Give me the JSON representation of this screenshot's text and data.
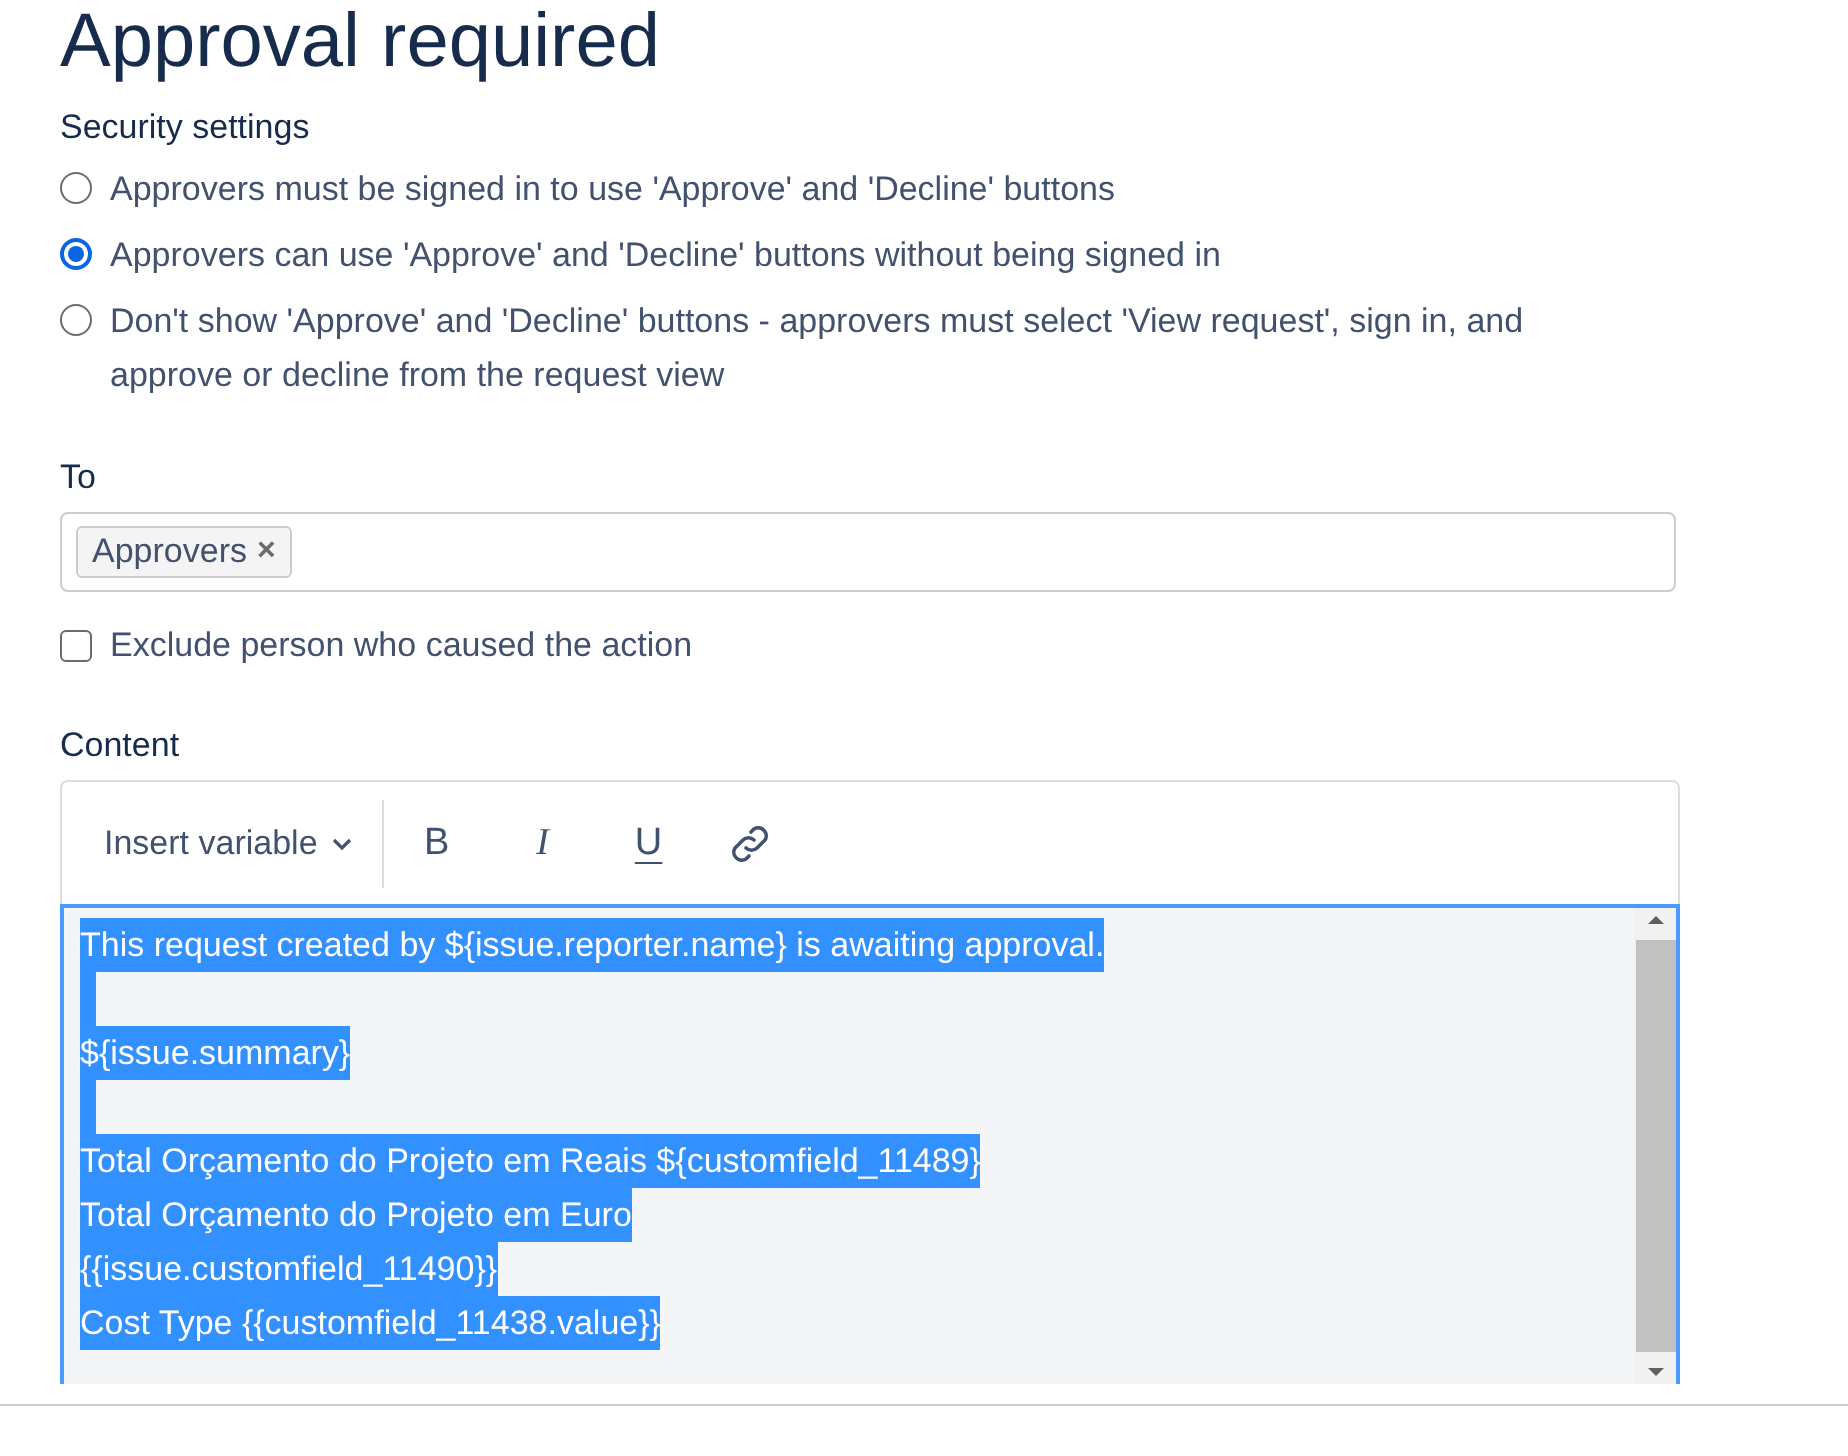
{
  "title": "Approval required",
  "security": {
    "label": "Security settings",
    "options": [
      {
        "label": "Approvers must be signed in to use 'Approve' and 'Decline' buttons",
        "selected": false
      },
      {
        "label": "Approvers can use 'Approve' and 'Decline' buttons without being signed in",
        "selected": true
      },
      {
        "label": "Don't show 'Approve' and 'Decline' buttons - approvers must select 'View request', sign in, and approve or decline from the request view",
        "selected": false
      }
    ]
  },
  "to": {
    "label": "To",
    "tags": [
      {
        "label": "Approvers",
        "remove": "×"
      }
    ]
  },
  "exclude": {
    "label": "Exclude person who caused the action",
    "checked": false
  },
  "content": {
    "label": "Content",
    "toolbar": {
      "insert_variable": "Insert variable",
      "bold": "B",
      "italic": "I",
      "underline": "U"
    },
    "selected": true,
    "lines": [
      {
        "kind": "text",
        "text": "This request created by ${issue.reporter.name} is awaiting approval."
      },
      {
        "kind": "blank"
      },
      {
        "kind": "text",
        "text": "${issue.summary}"
      },
      {
        "kind": "blank"
      },
      {
        "kind": "text",
        "text": "Total Orçamento do Projeto em Reais ${customfield_11489}"
      },
      {
        "kind": "text",
        "text": "Total Orçamento do Projeto em Euro"
      },
      {
        "kind": "text",
        "text": "{{issue.customfield_11490}}"
      },
      {
        "kind": "text",
        "text": "Cost Type {{customfield_11438.value}}"
      }
    ]
  }
}
